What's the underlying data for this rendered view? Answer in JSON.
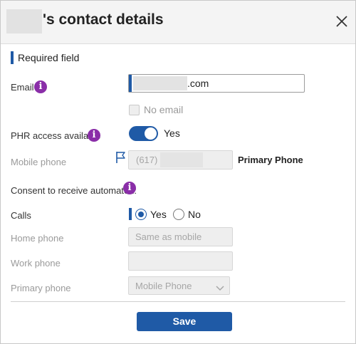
{
  "dialog": {
    "title": "'s contact details",
    "close_icon": "close-icon",
    "required_note": "Required field"
  },
  "email": {
    "label": "Email",
    "value": ".com",
    "no_email_label": "No email",
    "no_email_checked": false,
    "info_glyph": "i"
  },
  "phr": {
    "label": "PHR access available",
    "toggle_label": "Yes",
    "toggle_on": true,
    "info_glyph": "i"
  },
  "mobile": {
    "label": "Mobile phone",
    "value": "(617)",
    "primary_label": "Primary Phone",
    "flag_icon": "flag-icon"
  },
  "consent": {
    "label": "Consent to receive automated:",
    "info_glyph": "i"
  },
  "calls": {
    "label": "Calls",
    "options": [
      "Yes",
      "No"
    ],
    "selected": "Yes"
  },
  "home_phone": {
    "label": "Home phone",
    "value": "Same as mobile"
  },
  "work_phone": {
    "label": "Work phone",
    "value": ""
  },
  "primary_phone": {
    "label": "Primary phone",
    "value": "Mobile Phone"
  },
  "actions": {
    "save_label": "Save"
  },
  "colors": {
    "accent": "#1f5aa6",
    "info": "#8a2ea8",
    "disabled_bg": "#eeeeee"
  }
}
